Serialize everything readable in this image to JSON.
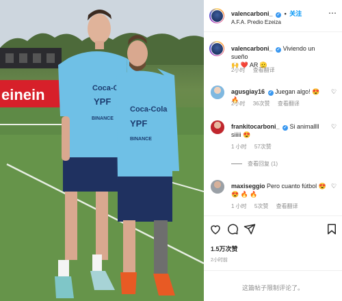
{
  "post": {
    "username": "valencarboni_",
    "follow_label": "关注",
    "location": "A.F.A. Predio Ezeiza"
  },
  "photo": {
    "jersey_sponsor": "Coca-Cola",
    "jersey_ypf": "YPF",
    "jersey_binance": "BINANCE",
    "board_text": "einein"
  },
  "caption": {
    "username": "valencarboni_",
    "text": "Viviendo un sueño",
    "text2": "🙌 ❤️ AR 🫡",
    "time": "2小时",
    "translate": "查看翻译"
  },
  "comments": [
    {
      "username": "agusgiay16",
      "text": "Juegan algo! 😍 🔥",
      "time": "2小时",
      "likes": "36次赞",
      "translate": "查看翻译"
    },
    {
      "username": "frankitocarboni_",
      "text": "Si animallll siiiii 😍",
      "time": "1 小时",
      "likes": "57次赞",
      "view_replies": "查看回复 (1)"
    },
    {
      "username": "maxiseggio",
      "text": "Pero cuanto fútbol 😍 😍 🔥 🔥",
      "time": "1 小时",
      "likes": "5次赞",
      "translate": "查看翻译"
    }
  ],
  "likes_count": "1.5万次赞",
  "time_ago": "2小时前",
  "comments_disabled": "这篇帖子限制评论了。",
  "colors": {
    "accent": "#0095f6",
    "verified": "#3897f0",
    "muted": "#8e8e8e"
  }
}
